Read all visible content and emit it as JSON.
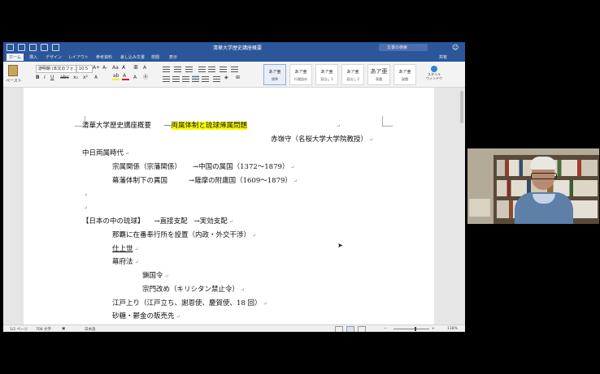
{
  "window": {
    "title": "清華大学歴史講座概要",
    "search_placeholder": "文書の検索",
    "share_label": "共有",
    "smiley": "☺"
  },
  "tabs": [
    "ホーム",
    "挿入",
    "デザイン",
    "レイアウト",
    "参考資料",
    "差し込み文書",
    "校閲",
    "表示"
  ],
  "ribbon": {
    "paste_label": "ペースト",
    "font_name": "游明朝 (本文のフォ...",
    "font_size": "10.5",
    "styles": [
      {
        "preview": "あア亜",
        "name": "標準"
      },
      {
        "preview": "あア亜",
        "name": "行間詰め"
      },
      {
        "preview": "あア亜",
        "name": "見出し 1"
      },
      {
        "preview": "あア亜",
        "name": "見出し 2"
      },
      {
        "preview": "あア亜",
        "name": "表題"
      },
      {
        "preview": "あア亜",
        "name": "副題"
      }
    ],
    "styles_pane_label": "スタイル\nウィンドウ"
  },
  "document": {
    "line1_left": "清華大学歴史講座概要",
    "line1_dash": "―",
    "line1_highlight": "両属体制と琉球帰属問題",
    "line2": "赤嶺守（名桜大学大学院教授）",
    "line3": "中日両属時代",
    "line4a": "宗属関係（宗藩関係）",
    "line4b": "→中国の属国（1372～1879）",
    "line5a": "幕藩体制下の異国",
    "line5b": "→薩摩の附庸国（1609～1879）",
    "line6": "【日本の中の琉球】",
    "line6b": "→直接支配",
    "line6c": "→実効支配",
    "line7": "那覇に在番奉行所を設置（内政・外交干渉）",
    "line8": "仕上世",
    "line9": "幕府法",
    "line10": "鎖国令",
    "line11": "宗門改め（キリシタン禁止令）",
    "line12": "江戸上り（江戸立ち、謝恩使、慶賀使、18 回）",
    "line13": "砂糖・鬱金の販売先",
    "para_mark": "↵"
  },
  "statusbar": {
    "page": "1/2 ページ",
    "words": "708 文字",
    "language": "日本語",
    "zoom": "118%"
  },
  "colors": {
    "title_bar": "#2b579a",
    "highlight": "#ffff00"
  }
}
